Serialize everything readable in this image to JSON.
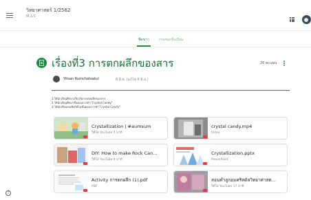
{
  "header": {
    "class_title": "วิทยาศาสตร์ 1/2562",
    "class_section": "M.1/1"
  },
  "tabs": [
    {
      "label": "ฟีดข่าว",
      "active": true
    },
    {
      "label": "งานของชั้นเรียน",
      "active": false
    }
  ],
  "assignment": {
    "title": "เรื่องที่3 การตกผลึกของสาร",
    "points": "20 คะแนน",
    "teacher": "Yitsan Rumchatsakul",
    "posted": "6 มิ.ย. (แก้ไข 6 มิ.ย.)",
    "instructions": [
      "1.ให้นักเรียนศึกษาเกี่ยวกับการตกผลึกของสาร",
      "2.ให้นักเรียนศึกษาขั้นตอนการทำ\"Crystal Candy\"",
      "3.ให้นักเรียนส่งผลิตวิดีโอขั้นตอนการทำ\"Crystal Candy\""
    ]
  },
  "attachments": [
    {
      "title": "Crystallization | #aumsum",
      "subtitle": "วิดีโอ YouTube 4 นาที",
      "thumb": "video-illustration"
    },
    {
      "title": "crystal candy.mp4",
      "subtitle": "Video",
      "thumb": "video-photo"
    },
    {
      "title": "DIY: How to make Rock Can...",
      "subtitle": "วิดีโอ YouTube 4 นาที",
      "thumb": "video-illustration"
    },
    {
      "title": "Crystallization.pptx",
      "subtitle": "PowerPoint",
      "thumb": "slides"
    },
    {
      "title": "Activity การตกผลึก (1).pdf",
      "subtitle": "PDF",
      "thumb": "document"
    },
    {
      "title": "สอนทำลูกอมคริสตัลวิทยาศาสต...",
      "subtitle": "วิดีโอ YouTube 17 นาที",
      "thumb": "video-photo"
    }
  ],
  "icons": {
    "menu": "menu-icon",
    "apps": "apps-grid-icon",
    "assignment": "assignment-icon",
    "more": "more-vert-icon",
    "help": "help-icon"
  },
  "colors": {
    "accent": "#1e8e3e",
    "title": "#137333"
  }
}
